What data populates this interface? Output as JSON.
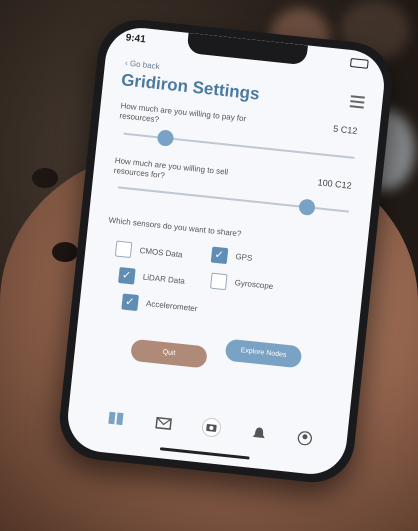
{
  "status": {
    "time": "9:41"
  },
  "header": {
    "back_label": "Go back",
    "title": "Gridiron Settings"
  },
  "resources": {
    "pay": {
      "question": "How much are you willing to pay for resources?",
      "value": "5 C12",
      "level": 0.18
    },
    "sell": {
      "question": "How much are you willing to sell resources for?",
      "value": "100 C12",
      "level": 0.82
    }
  },
  "sensors": {
    "question": "Which sensors do you want to share?",
    "items": [
      {
        "label": "CMOS Data",
        "checked": false
      },
      {
        "label": "GPS",
        "checked": true
      },
      {
        "label": "LiDAR Data",
        "checked": true
      },
      {
        "label": "Gyroscope",
        "checked": false
      },
      {
        "label": "Accelerometer",
        "checked": true
      }
    ]
  },
  "actions": {
    "left_button": "Quit",
    "right_button": "Explore Nodes"
  },
  "colors": {
    "accent": "#4a7a9e",
    "check": "#5f8db4",
    "quit": "#b08a78",
    "explore": "#7aa2c4"
  },
  "tabs": [
    "grid-icon",
    "message-icon",
    "camera-icon",
    "bell-icon",
    "user-icon"
  ]
}
